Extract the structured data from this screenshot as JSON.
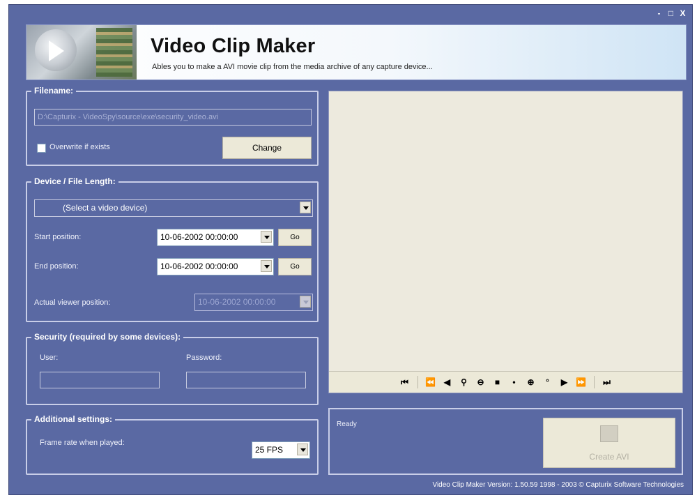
{
  "window": {
    "controls": {
      "minimize": "-",
      "maximize": "□",
      "close": "X"
    }
  },
  "header": {
    "title": "Video Clip Maker",
    "subtitle": "Ables you to make a AVI movie clip from the media archive of any capture device..."
  },
  "filename": {
    "legend": "Filename:",
    "path": "D:\\Capturix - VideoSpy\\source\\exe\\security_video.avi",
    "overwrite_label": "Overwrite if exists",
    "change_label": "Change"
  },
  "device": {
    "legend": "Device / File Length:",
    "select_value": "(Select a video device)",
    "start_label": "Start position:",
    "start_value": "10-06-2002 00:00:00",
    "end_label": "End position:",
    "end_value": "10-06-2002 00:00:00",
    "go_label": "Go",
    "actual_label": "Actual viewer position:",
    "actual_value": "10-06-2002 00:00:00"
  },
  "security": {
    "legend": "Security (required by some devices):",
    "user_label": "User:",
    "password_label": "Password:"
  },
  "additional": {
    "legend": "Additional settings:",
    "frame_rate_label": "Frame rate when played:",
    "frame_rate_value": "25 FPS"
  },
  "player": {
    "icons": [
      "skip-to-start-icon",
      "fast-rewind-icon",
      "step-back-icon",
      "zoom-in-small-icon",
      "zoom-out-icon",
      "stop-icon",
      "dot-icon",
      "zoom-in-icon",
      "zoom-small-icon",
      "play-icon",
      "fast-forward-icon",
      "skip-to-end-icon"
    ]
  },
  "status": {
    "text": "Ready",
    "create_label": "Create AVI"
  },
  "footer": {
    "text": "Video Clip Maker   Version: 1.50.59    1998 - 2003 © Capturix Software Technologies"
  },
  "colors": {
    "window_bg": "#5a69a3",
    "panel_bg": "#ece9d8",
    "header_accent": "#cfe4f5"
  }
}
